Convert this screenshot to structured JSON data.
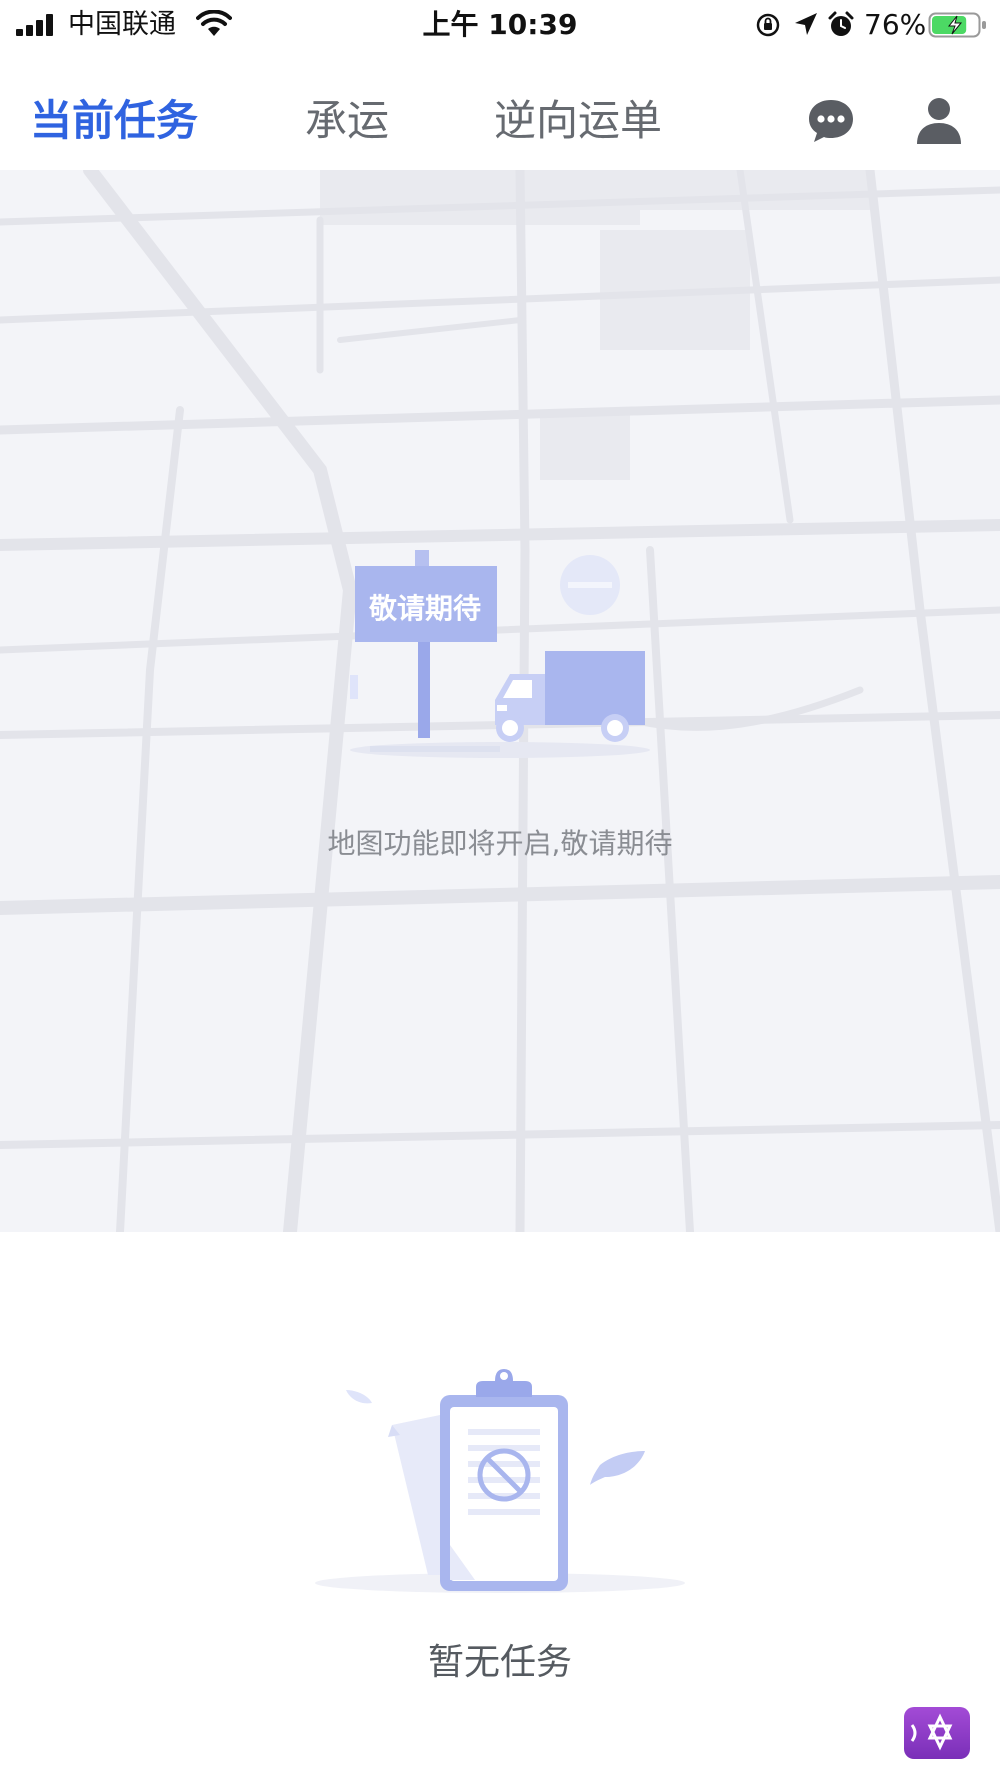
{
  "status_bar": {
    "carrier": "中国联通",
    "time": "上午 10:39",
    "battery_percent": "76%",
    "battery_level": 0.76,
    "icons": [
      "signal-icon",
      "wifi-icon",
      "orientation-lock-icon",
      "location-icon",
      "alarm-icon",
      "battery-icon"
    ]
  },
  "nav": {
    "tabs": [
      {
        "label": "当前任务",
        "active": true
      },
      {
        "label": "承运",
        "active": false
      },
      {
        "label": "逆向运单",
        "active": false
      }
    ],
    "icons": [
      "chat-icon",
      "user-icon"
    ],
    "colors": {
      "active": "#2f63e0",
      "inactive": "#666a70"
    }
  },
  "map": {
    "sign_text": "敬请期待",
    "caption": "地图功能即将开启,敬请期待",
    "icons": [
      "signpost-icon",
      "truck-icon"
    ]
  },
  "tasks": {
    "empty_text": "暂无任务",
    "icons": [
      "empty-clipboard-icon"
    ]
  },
  "float_button": {
    "icon": "star-of-david-icon",
    "color": "#8e3cc8"
  }
}
